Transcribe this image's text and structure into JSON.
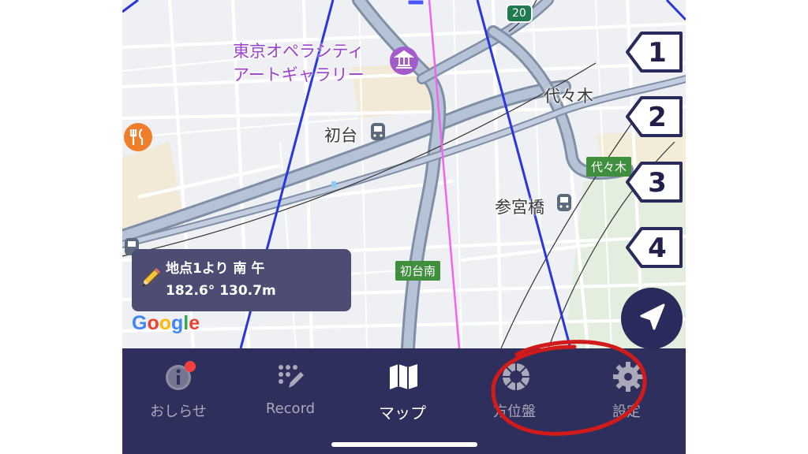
{
  "map": {
    "poi_name_line1": "東京オペラシティ",
    "poi_name_line2": "アートギャラリー",
    "label_hatsudai": "初台",
    "label_yoyogi": "代々木",
    "label_sangubashi": "参宮橋",
    "station_hatsudai_minami": "初台南",
    "station_yoyogi": "代々木",
    "route_number": "20",
    "google_logo": {
      "letters": [
        "G",
        "o",
        "o",
        "g",
        "l",
        "e"
      ],
      "colors": [
        "#4285F4",
        "#EA4335",
        "#FBBC05",
        "#4285F4",
        "#34A853",
        "#EA4335"
      ]
    }
  },
  "markers": [
    {
      "label": "1"
    },
    {
      "label": "2"
    },
    {
      "label": "3"
    },
    {
      "label": "4"
    }
  ],
  "info": {
    "line1": "地点1より 南 午",
    "line2": "182.6° 130.7m"
  },
  "tabs": [
    {
      "label": "おしらせ",
      "icon": "info-icon",
      "has_badge": true
    },
    {
      "label": "Record",
      "icon": "record-pen-icon"
    },
    {
      "label": "マップ",
      "icon": "map-icon",
      "active": true
    },
    {
      "label": "方位盤",
      "icon": "compass-dial-icon",
      "annotated": true
    },
    {
      "label": "設定",
      "icon": "gear-icon"
    }
  ],
  "colors": {
    "tabbar_bg": "#2f2f5d",
    "info_bg": "#4d4c72",
    "bearing_lines": "#2a35e0",
    "center_line": "#ee66ee",
    "annotation_red": "#d11a1a",
    "badge_red": "#f04040"
  }
}
